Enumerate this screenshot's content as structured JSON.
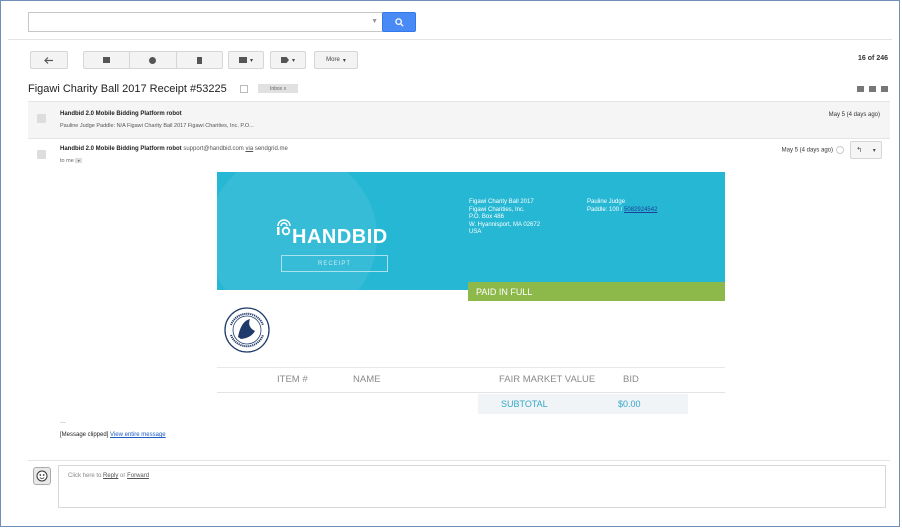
{
  "search": {
    "placeholder": "",
    "button_icon": "search-icon"
  },
  "toolbar": {
    "back_icon": "arrow-left-icon",
    "archive_icon": "archive-icon",
    "spam_icon": "report-spam-icon",
    "delete_icon": "trash-icon",
    "folder_icon": "folder-icon",
    "label_icon": "label-icon",
    "more_label": "More",
    "page_count": "16 of 246"
  },
  "thread": {
    "subject": "Figawi Charity Ball 2017 Receipt #53225",
    "tag": "Inbox",
    "tag_close": "x"
  },
  "messages": [
    {
      "from": "Handbid 2.0 Mobile Bidding Platform robot",
      "snippet": "Pauline Judge Paddle: N/A Figawi Charity Ball 2017 Figawi Charities, Inc. P.O...",
      "date": "May 5 (4 days ago)"
    },
    {
      "from": "Handbid 2.0 Mobile Bidding Platform robot",
      "email": "support@handbid.com",
      "via_word": "via",
      "via_domain": "sendgrid.me",
      "to": "to me",
      "date": "May 5 (4 days ago)"
    }
  ],
  "receipt": {
    "brand": "HANDBID",
    "receipt_label": "RECEIPT",
    "org_lines": [
      "Figawi Charity Ball 2017",
      "Figawi Charities, Inc.",
      "P.O. Box 486",
      "W. Hyannisport, MA 02672",
      "USA"
    ],
    "bidder_name": "Pauline Judge",
    "paddle_label": "Paddle: 100 /",
    "phone": "5082924542",
    "paid_label": "PAID IN FULL",
    "columns": [
      "ITEM #",
      "NAME",
      "FAIR MARKET VALUE",
      "BID"
    ],
    "subtotal_label": "SUBTOTAL",
    "subtotal_value": "$0.00",
    "colors": {
      "banner": "#25b7d3",
      "paid": "#8db84a",
      "subtotal_text": "#35a6c9"
    }
  },
  "footer": {
    "ellipsis": "...",
    "clipped": "[Message clipped]",
    "view_entire": "View entire message",
    "reply_prefix": "Click here to",
    "reply_link": "Reply",
    "or_word": "or",
    "forward_link": "Forward"
  }
}
